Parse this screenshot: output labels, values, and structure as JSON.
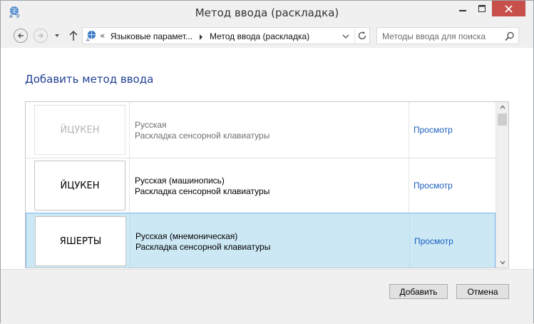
{
  "window": {
    "title": "Метод ввода (раскладка)"
  },
  "address": {
    "sep": "«",
    "crumb1": "Языковые парамет...",
    "crumb2": "Метод ввода (раскладка)"
  },
  "search": {
    "placeholder": "Методы ввода для поиска"
  },
  "heading": "Добавить метод ввода",
  "layouts": [
    {
      "keyboard": "ЙЦУКЕН",
      "name": "Русская",
      "type": "Раскладка сенсорной клавиатуры",
      "preview": "Просмотр",
      "dimmed": true
    },
    {
      "keyboard": "ЙЦУКЕН",
      "name": "Русская (машинопись)",
      "type": "Раскладка сенсорной клавиатуры",
      "preview": "Просмотр",
      "dimmed": false
    },
    {
      "keyboard": "ЯШЕРТЫ",
      "name": "Русская (мнемоническая)",
      "type": "Раскладка сенсорной клавиатуры",
      "preview": "Просмотр",
      "selected": true
    }
  ],
  "buttons": {
    "add": "Добавить",
    "cancel": "Отмена"
  },
  "colors": {
    "accent_link": "#1b5fbf",
    "heading": "#1f3f95",
    "selection": "#cce8f5",
    "close_button": "#c7504b"
  }
}
